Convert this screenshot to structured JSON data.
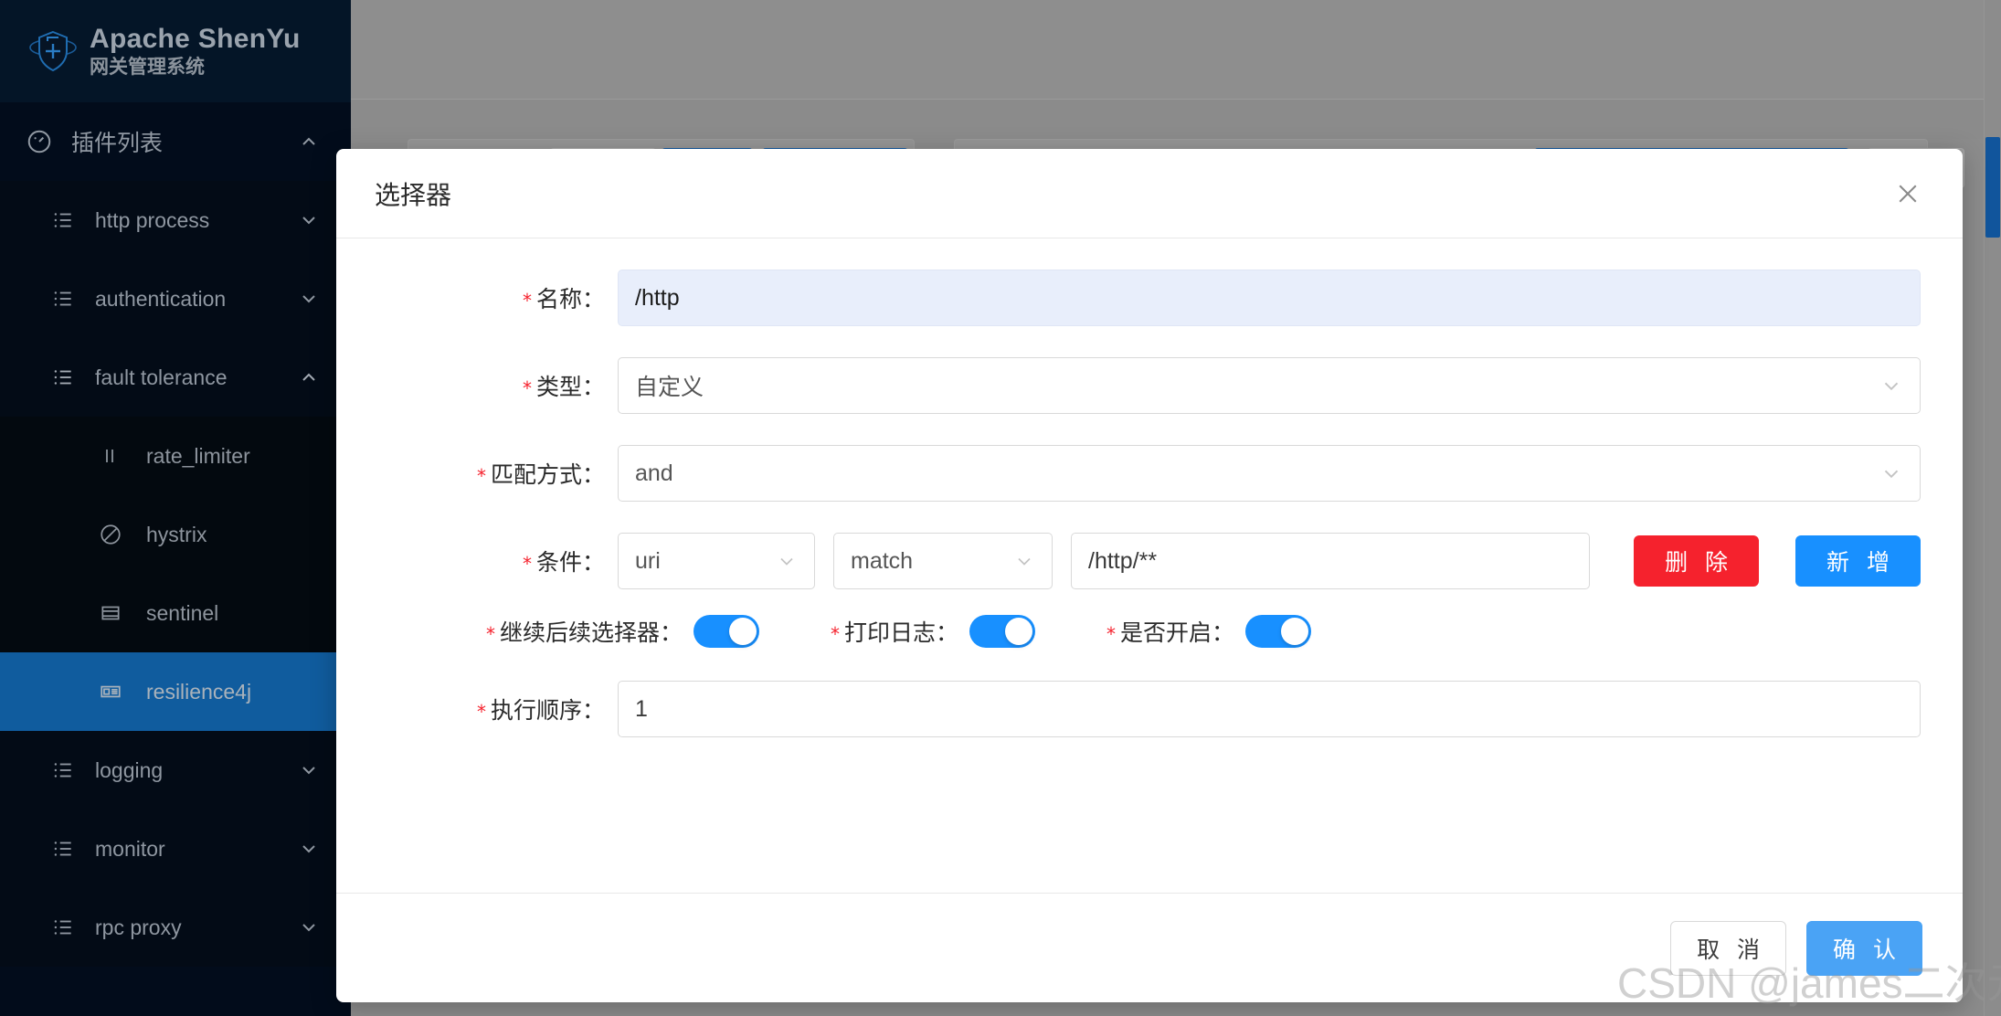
{
  "brand": {
    "title": "Apache ShenYu",
    "subtitle": "网关管理系统",
    "logo_icon": "shield-plus-icon"
  },
  "sidebar": {
    "group": {
      "label": "插件列表",
      "icon": "dashboard-icon",
      "chevron": "chevron-up-icon"
    },
    "items": [
      {
        "label": "http process",
        "icon": "list-icon",
        "chevron": "chevron-down-icon",
        "type": "group"
      },
      {
        "label": "authentication",
        "icon": "list-icon",
        "chevron": "chevron-down-icon",
        "type": "group"
      },
      {
        "label": "fault tolerance",
        "icon": "list-icon",
        "chevron": "chevron-up-icon",
        "type": "group"
      },
      {
        "label": "rate_limiter",
        "icon": "pause-icon",
        "type": "sub",
        "active": false
      },
      {
        "label": "hystrix",
        "icon": "ban-icon",
        "type": "sub",
        "active": false
      },
      {
        "label": "sentinel",
        "icon": "window-icon",
        "type": "sub",
        "active": false
      },
      {
        "label": "resilience4j",
        "icon": "panel-icon",
        "type": "sub",
        "active": true
      },
      {
        "label": "logging",
        "icon": "list-icon",
        "chevron": "chevron-down-icon",
        "type": "group"
      },
      {
        "label": "monitor",
        "icon": "list-icon",
        "chevron": "chevron-down-icon",
        "type": "group"
      },
      {
        "label": "rpc proxy",
        "icon": "list-icon",
        "chevron": "chevron-down-icon",
        "type": "group"
      }
    ]
  },
  "modal": {
    "title": "选择器",
    "close_icon": "close-icon",
    "fields": {
      "name": {
        "label": "名称：",
        "value": "/http",
        "required": true
      },
      "type": {
        "label": "类型：",
        "value": "自定义",
        "required": true,
        "chevron": "chevron-down-icon"
      },
      "match_mode": {
        "label": "匹配方式：",
        "value": "and",
        "required": true,
        "chevron": "chevron-down-icon"
      },
      "condition": {
        "label": "条件：",
        "required": true,
        "param_type": "uri",
        "operator": "match",
        "value": "/http/**",
        "delete_label": "删 除",
        "add_label": "新 增"
      },
      "order": {
        "label": "执行顺序：",
        "value": "1",
        "required": true
      }
    },
    "toggles": [
      {
        "label": "继续后续选择器：",
        "on": true,
        "required": true
      },
      {
        "label": "打印日志：",
        "on": true,
        "required": true
      },
      {
        "label": "是否开启：",
        "on": true,
        "required": true
      }
    ],
    "footer": {
      "cancel_label": "取 消",
      "confirm_label": "确 认"
    }
  },
  "watermark": "CSDN @james二次元",
  "colors": {
    "sidebar_bg": "#020c1b",
    "sidebar_active": "#105c9e",
    "primary_blue": "#1890ff",
    "danger_red": "#f5222d",
    "confirm_blue": "#4aa3f5",
    "mask_gray": "#8c8c8c"
  }
}
